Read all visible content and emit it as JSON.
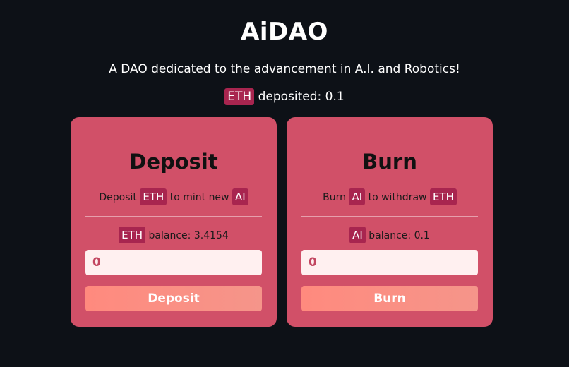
{
  "header": {
    "title": "AiDAO",
    "subtitle": "A DAO dedicated to the advancement in A.I. and Robotics!",
    "deposited_token": "ETH",
    "deposited_label": "deposited: 0.1"
  },
  "deposit_card": {
    "title": "Deposit",
    "desc_prefix": "Deposit",
    "desc_token1": "ETH",
    "desc_middle": "to mint new",
    "desc_token2": "AI",
    "balance_token": "ETH",
    "balance_label": "balance: 3.4154",
    "input_value": "0",
    "button_label": "Deposit"
  },
  "burn_card": {
    "title": "Burn",
    "desc_prefix": "Burn",
    "desc_token1": "AI",
    "desc_middle": "to withdraw",
    "desc_token2": "ETH",
    "balance_token": "AI",
    "balance_label": "balance: 0.1",
    "input_value": "0",
    "button_label": "Burn"
  },
  "colors": {
    "background": "#0d1117",
    "card": "#d15068",
    "tag": "#a8254f",
    "input_bg": "#fff0f0",
    "button_start": "#ff8a7e",
    "button_end": "#f5958a"
  }
}
